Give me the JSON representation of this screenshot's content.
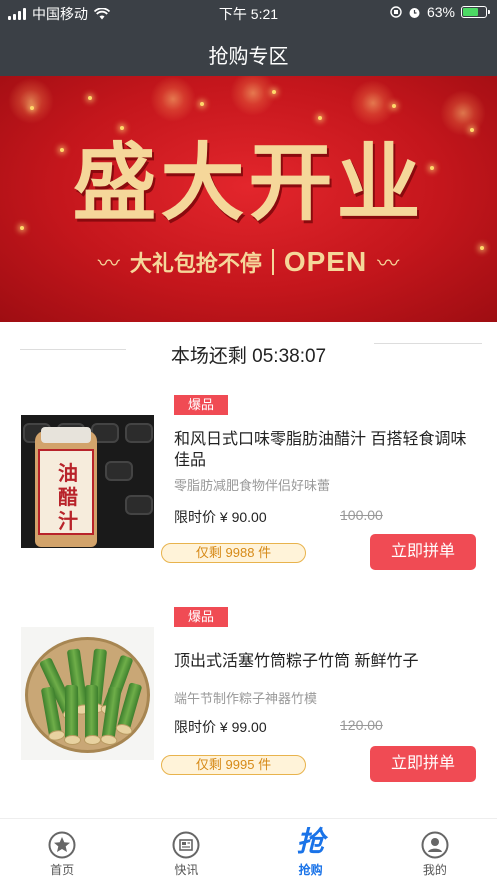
{
  "status_bar": {
    "carrier": "中国移动",
    "time": "下午 5:21",
    "battery": "63%",
    "battery_level": 0.63
  },
  "nav": {
    "title": "抢购专区"
  },
  "banner": {
    "title": "盛大开业",
    "subtitle": "大礼包抢不停",
    "subtitle_en": "OPEN"
  },
  "countdown": {
    "text": "本场还剩 05:38:07"
  },
  "products": [
    {
      "tag": "爆品",
      "title": "和风日式口味零脂肪油醋汁 百搭轻食调味佳品",
      "subtitle": "零脂肪减肥食物伴侣好味蕾",
      "price": "限时价 ¥ 90.00",
      "original_price": "100.00",
      "stock": "仅剩 9988 件",
      "button": "立即拼单",
      "image_text": [
        "油",
        "醋",
        "汁"
      ]
    },
    {
      "tag": "爆品",
      "title": "顶出式活塞竹筒粽子竹筒 新鲜竹子",
      "subtitle": "端午节制作粽子神器竹模",
      "price": "限时价 ¥ 99.00",
      "original_price": "120.00",
      "stock": "仅剩 9995 件",
      "button": "立即拼单"
    }
  ],
  "tabbar": [
    {
      "label": "首页",
      "icon": "star-circle-icon"
    },
    {
      "label": "快讯",
      "icon": "news-icon"
    },
    {
      "label": "抢购",
      "icon": "qiang-char-icon",
      "icon_text": "抢",
      "active": true
    },
    {
      "label": "我的",
      "icon": "user-icon"
    }
  ],
  "colors": {
    "header_bg": "#3b4046",
    "accent_red": "#f04b54",
    "stock_orange": "#d68a18",
    "active_blue": "#1a73e8"
  }
}
